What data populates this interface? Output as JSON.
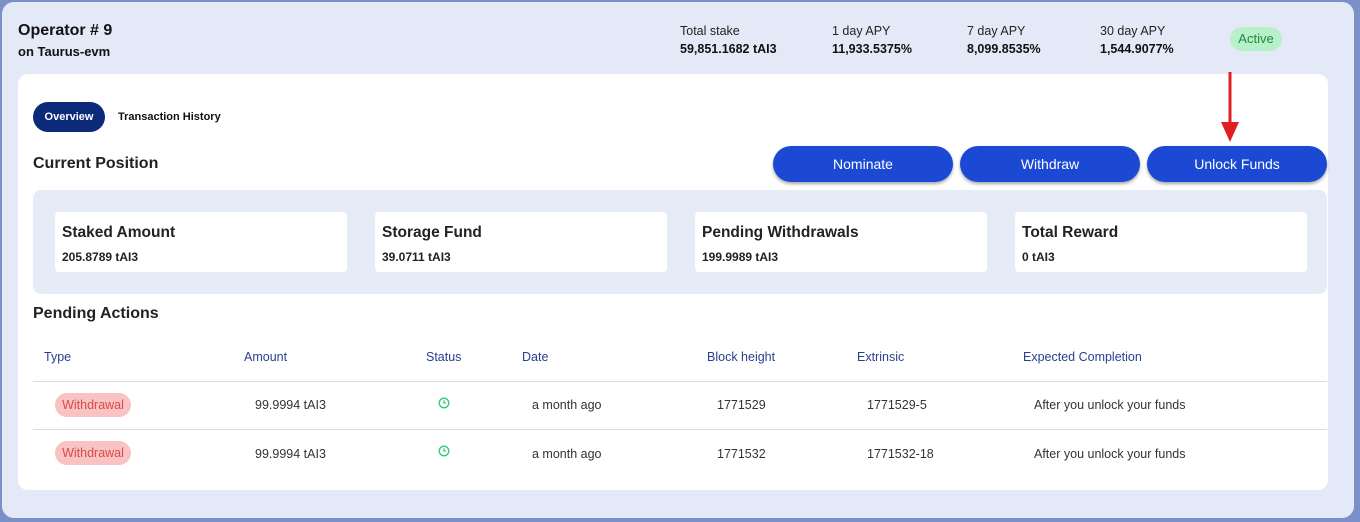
{
  "header": {
    "title": "Operator # 9",
    "subtitle": "on Taurus-evm",
    "stats": [
      {
        "label": "Total stake",
        "value": "59,851.1682 tAI3"
      },
      {
        "label": "1 day APY",
        "value": "11,933.5375%"
      },
      {
        "label": "7 day APY",
        "value": "8,099.8535%"
      },
      {
        "label": "30 day APY",
        "value": "1,544.9077%"
      }
    ],
    "status": "Active",
    "status_color": "#1e8a3e"
  },
  "tabs": [
    {
      "label": "Overview",
      "active": true
    },
    {
      "label": "Transaction History",
      "active": false
    }
  ],
  "current_position": {
    "title": "Current Position",
    "buttons": [
      "Nominate",
      "Withdraw",
      "Unlock Funds"
    ],
    "boxes": [
      {
        "title": "Staked Amount",
        "value": "205.8789 tAI3"
      },
      {
        "title": "Storage Fund",
        "value": "39.0711 tAI3"
      },
      {
        "title": "Pending Withdrawals",
        "value": "199.9989 tAI3"
      },
      {
        "title": "Total Reward",
        "value": "0 tAI3"
      }
    ]
  },
  "pending_actions": {
    "title": "Pending Actions",
    "columns": [
      "Type",
      "Amount",
      "Status",
      "Date",
      "Block height",
      "Extrinsic",
      "Expected Completion"
    ],
    "rows": [
      {
        "type": "Withdrawal",
        "amount": "99.9994 tAI3",
        "status_icon": "clock-icon",
        "date": "a month ago",
        "block": "1771529",
        "extrinsic": "1771529-5",
        "completion": "After you unlock your funds"
      },
      {
        "type": "Withdrawal",
        "amount": "99.9994 tAI3",
        "status_icon": "clock-icon",
        "date": "a month ago",
        "block": "1771532",
        "extrinsic": "1771532-18",
        "completion": "After you unlock your funds"
      }
    ]
  },
  "colors": {
    "primary_button": "#1c49d4",
    "active_tab": "#0d2a7a",
    "withdrawal_badge_bg": "#f9c3c3",
    "withdrawal_badge_text": "#d94b4b",
    "pending_status": "#2ecc71",
    "annotation_arrow": "#e02020"
  }
}
